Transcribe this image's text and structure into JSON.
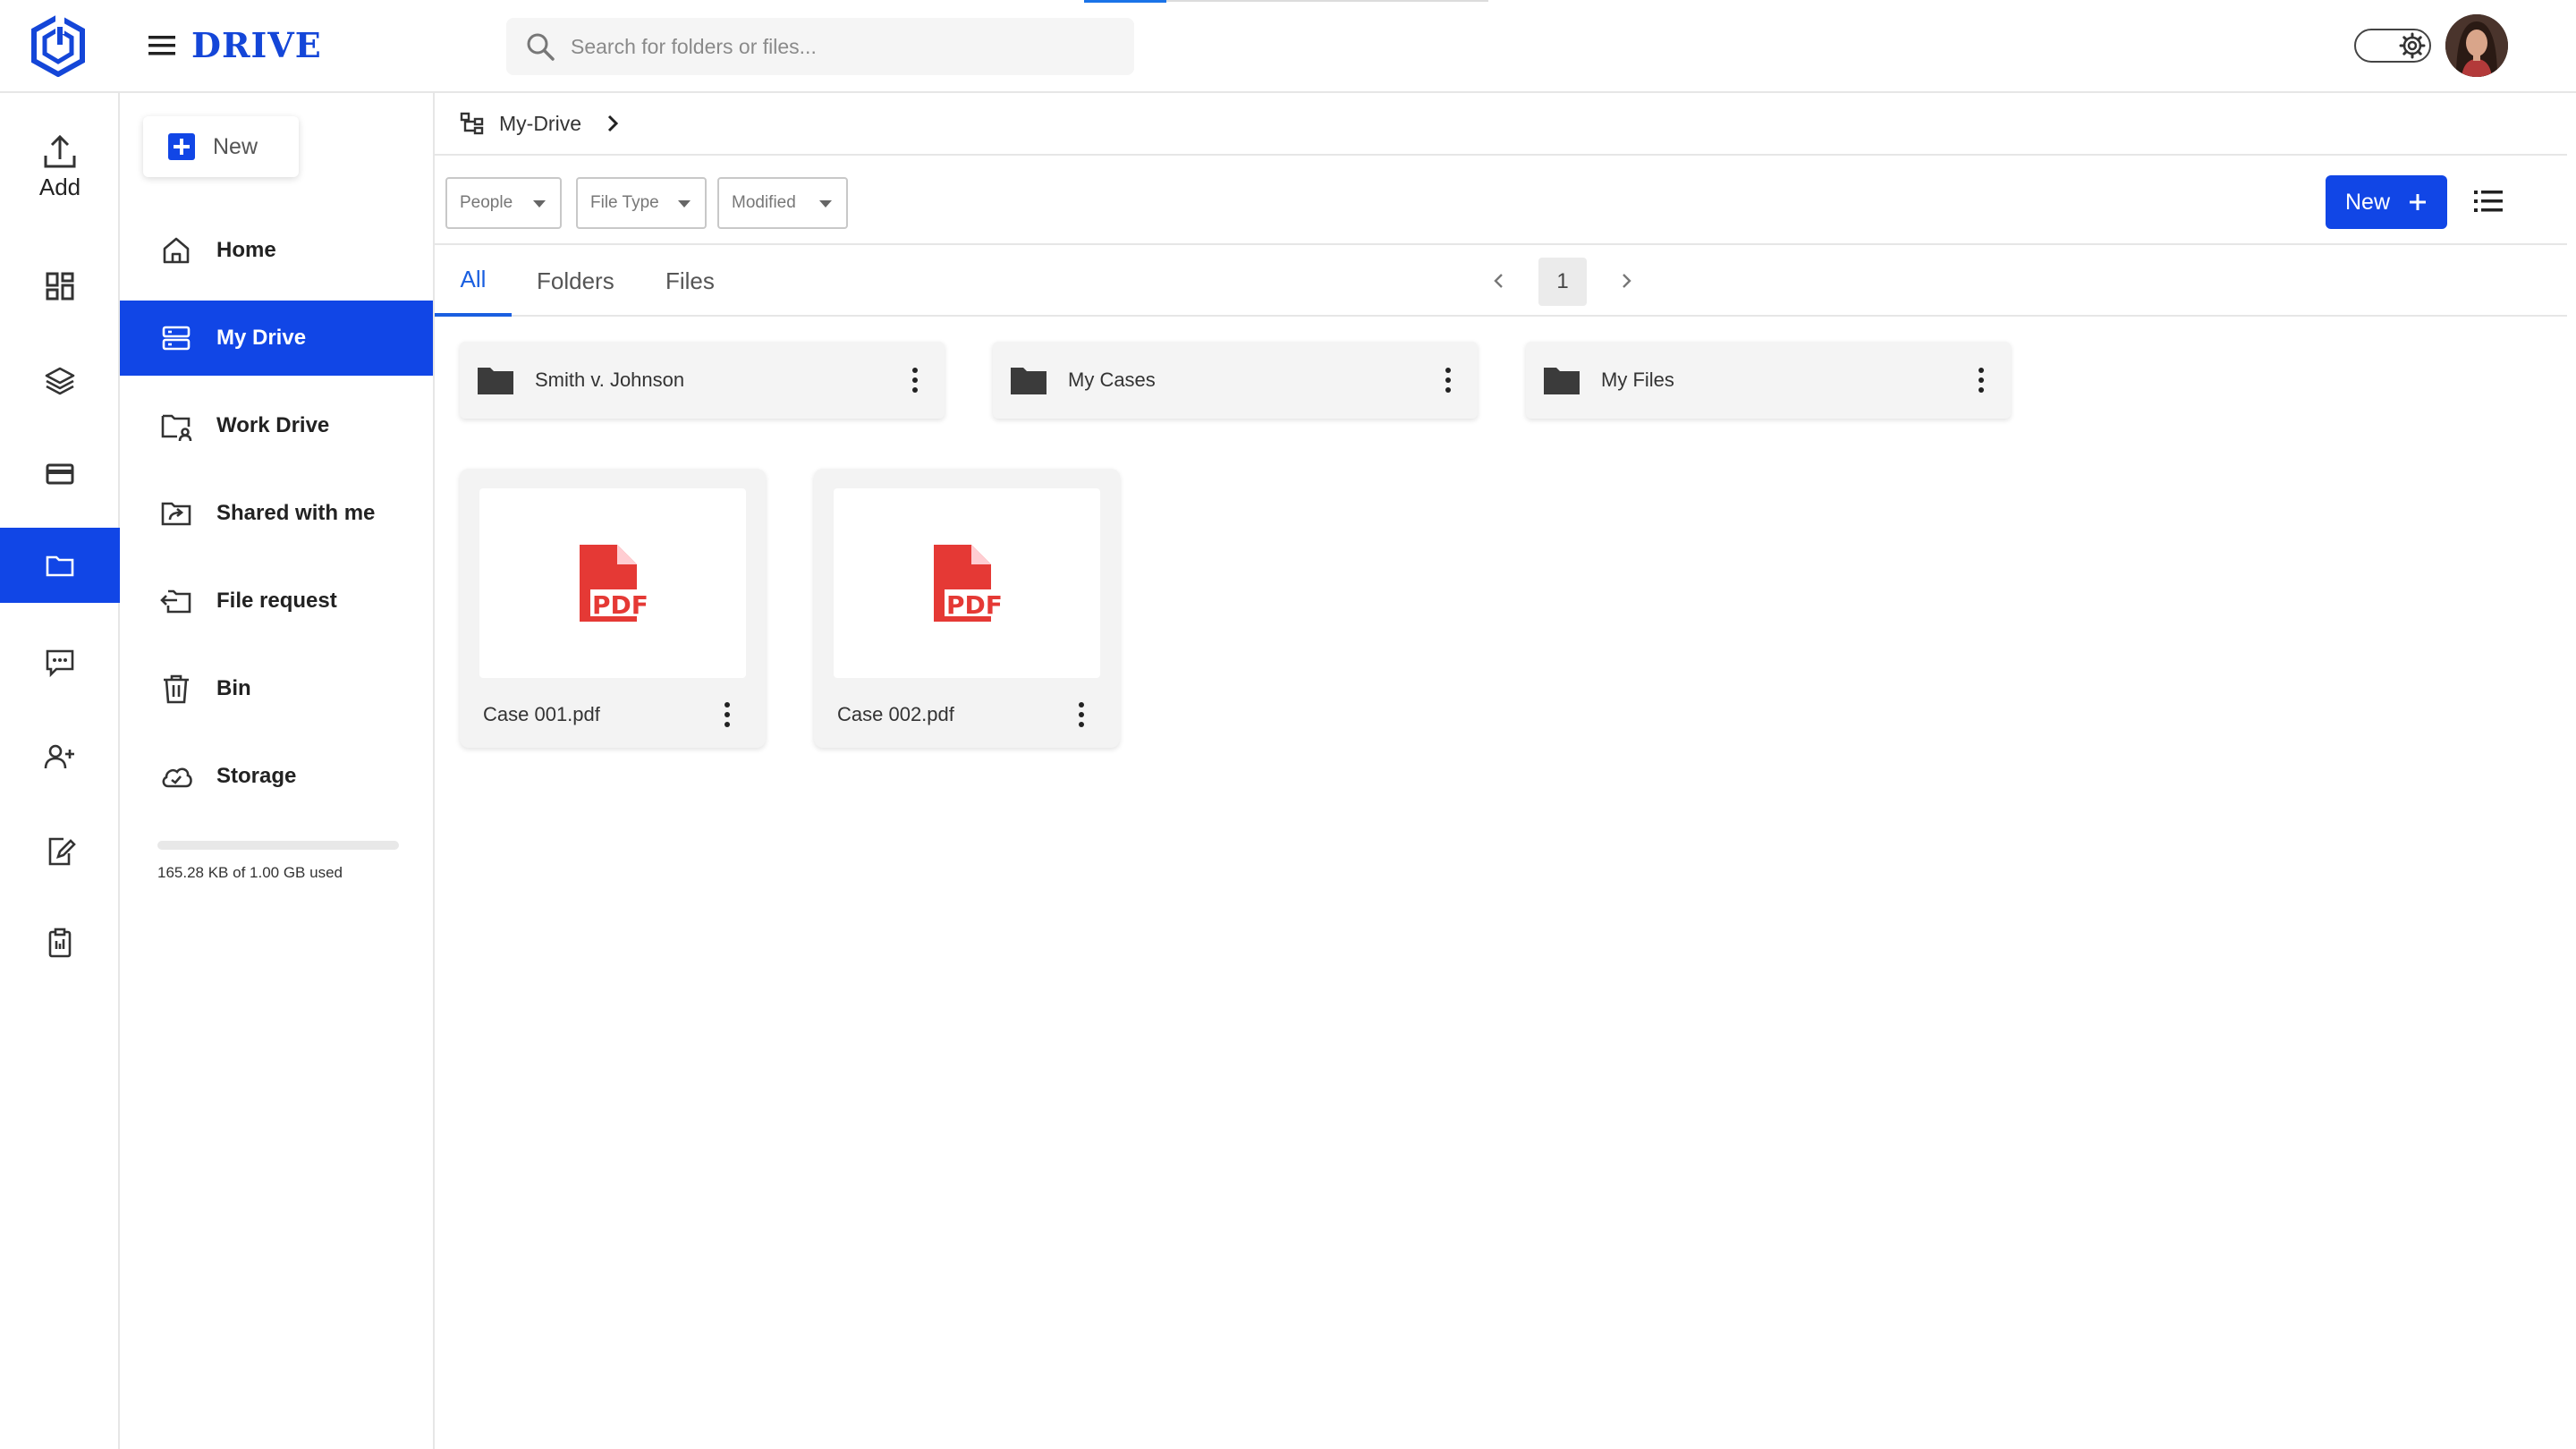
{
  "app": {
    "brand": "DRIVE"
  },
  "search": {
    "placeholder": "Search for folders or files..."
  },
  "rail": {
    "add_label": "Add",
    "items": [
      "dashboard-icon",
      "layers-icon",
      "card-icon",
      "folder-icon",
      "chat-icon",
      "add-user-icon",
      "edit-document-icon",
      "clipboard-icon"
    ],
    "active": "folder-icon"
  },
  "sidebar": {
    "new_label": "New",
    "items": [
      {
        "label": "Home",
        "icon": "home-icon"
      },
      {
        "label": "My Drive",
        "icon": "drive-icon",
        "active": true
      },
      {
        "label": "Work Drive",
        "icon": "work-drive-icon"
      },
      {
        "label": "Shared with me",
        "icon": "shared-folder-icon"
      },
      {
        "label": "File request",
        "icon": "file-request-icon"
      },
      {
        "label": "Bin",
        "icon": "trash-icon"
      },
      {
        "label": "Storage",
        "icon": "cloud-icon"
      }
    ],
    "storage": {
      "text": "165.28 KB of 1.00 GB used",
      "used_fraction": 0.0002
    }
  },
  "breadcrumb": {
    "label": "My-Drive"
  },
  "filters": [
    "People",
    "File Type",
    "Modified"
  ],
  "toolbar": {
    "new_label": "New"
  },
  "tabs": [
    "All",
    "Folders",
    "Files"
  ],
  "active_tab": "All",
  "pagination": {
    "page": "1"
  },
  "folders": [
    "Smith v. Johnson",
    "My Cases",
    "My Files"
  ],
  "files": [
    {
      "name": "Case 001.pdf",
      "type": "PDF"
    },
    {
      "name": "Case 002.pdf",
      "type": "PDF"
    }
  ],
  "colors": {
    "accent": "#1146e6",
    "pdf": "#e53935",
    "tab_active": "#1a5fe0"
  }
}
